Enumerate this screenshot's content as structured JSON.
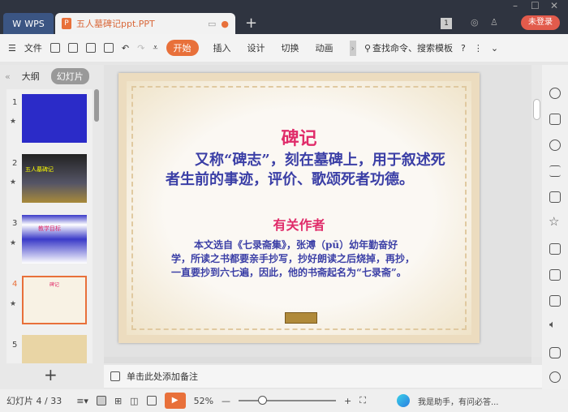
{
  "titlebar": {
    "wps_label": "WPS",
    "doc_tab": "五人墓碑记ppt.PPT",
    "new_tab": "+",
    "page_badge": "1",
    "login": "未登录",
    "min": "–",
    "max": "☐",
    "close": "✕"
  },
  "toolbar": {
    "file": "文件",
    "tabs": [
      "开始",
      "插入",
      "设计",
      "切换",
      "动画"
    ],
    "search": "查找命令、搜索模板",
    "help": "?"
  },
  "left_panel": {
    "outline_tab": "大纲",
    "slides_tab": "幻灯片",
    "collapse": "«",
    "add": "+",
    "thumbnails": [
      {
        "num": "1",
        "title": ""
      },
      {
        "num": "2",
        "title": "五人墓碑记"
      },
      {
        "num": "3",
        "title": "教学目标"
      },
      {
        "num": "4",
        "title": "碑记"
      },
      {
        "num": "5",
        "title": ""
      }
    ],
    "active": "4"
  },
  "slide": {
    "title": "碑记",
    "para1": "又称“碑志”，刻在墓碑上，用于叙述死者生前的事迹，评价、歌颂死者功德。",
    "subtitle": "有关作者",
    "para2": "本文选自《七录斋集》，张溥（pū）幼年勤奋好学，所读之书都要亲手抄写，抄好朗读之后烧掉，再抄，一直要抄到六七遍，因此，他的书斋起名为“七录斋”。"
  },
  "notes": {
    "placeholder": "单击此处添加备注"
  },
  "status": {
    "slide_count": "幻灯片 4 / 33",
    "zoom": "52%",
    "zoom_level_percent": 52,
    "ai_text": "我是助手，有问必答..."
  },
  "colors": {
    "accent": "#e8703a",
    "title_red": "#e02c6a",
    "body_blue": "#3b3fa6",
    "titlebar": "#2f3440"
  }
}
